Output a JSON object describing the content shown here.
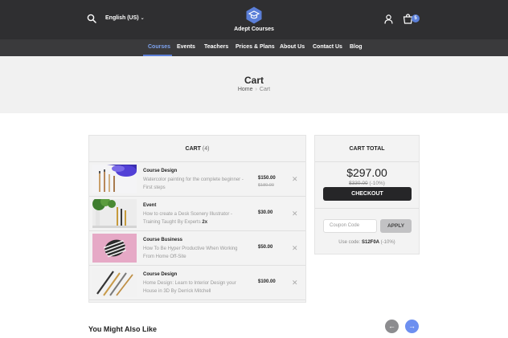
{
  "header": {
    "language": "English (US)",
    "brand": "Adept Courses",
    "cart_count": "5"
  },
  "nav": [
    "Courses",
    "Events",
    "Teachers",
    "Prices & Plans",
    "About Us",
    "Contact Us",
    "Blog"
  ],
  "page": {
    "title": "Cart",
    "breadcrumb_home": "Home",
    "breadcrumb_current": "Cart"
  },
  "cart": {
    "heading": "CART",
    "count": "(4)",
    "items": [
      {
        "category": "Course Design",
        "title": "Watercolor painting for the complete beginner - First steps",
        "price": "$150.00",
        "old_price": "$180.00"
      },
      {
        "category": "Event",
        "title": "How to create a Desk Scenery Illustrator - Training Taught By Experts",
        "quantity": "2x",
        "price": "$30.00"
      },
      {
        "category": "Course Business",
        "title": "How To Be Hyper Productive When Working From Home Off-Site",
        "price": "$50.00"
      },
      {
        "category": "Course Design",
        "title": "Home Design: Learn to Interior Design your House in 3D By Derrick Mitchell",
        "price": "$100.00"
      }
    ]
  },
  "totals": {
    "heading": "CART TOTAL",
    "amount": "$297.00",
    "old_amount": "$330.00",
    "discount": "(-10%)",
    "checkout_label": "CHECKOUT",
    "coupon_placeholder": "Coupon Code",
    "apply_label": "APPLY",
    "use_code_prefix": "Use code:",
    "use_code": "S12F0A",
    "use_code_discount": "(-10%)"
  },
  "related": {
    "heading": "You Might Also Like"
  },
  "colors": {
    "accent": "#5b7fd8",
    "header_bg": "#2f2f31",
    "nav_bg": "#3a3a3c"
  }
}
